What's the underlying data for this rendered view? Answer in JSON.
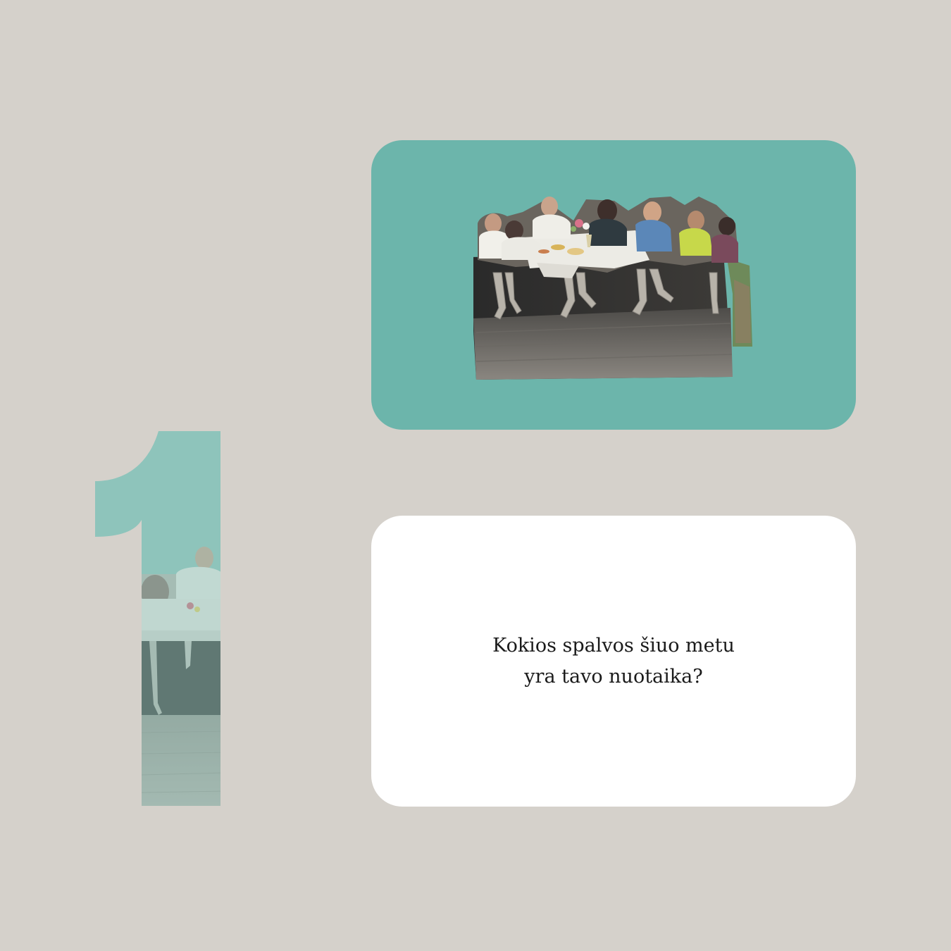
{
  "card_number": {
    "label": "1",
    "color": "#6cb5ab"
  },
  "image_card": {
    "background": "#6cb5ab",
    "image": "collage-family-table"
  },
  "question_card": {
    "background": "#ffffff",
    "lines": [
      "Kokios spalvos šiuo metu",
      "yra tavo nuotaika?"
    ]
  },
  "page": {
    "background": "#d5d1cb"
  }
}
